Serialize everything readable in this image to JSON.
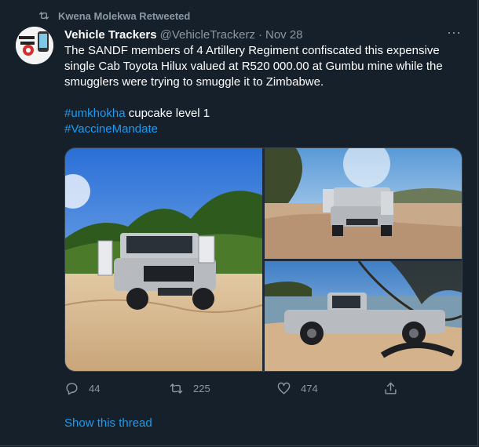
{
  "retweet": {
    "text": "Kwena Molekwa Retweeted"
  },
  "tweet": {
    "author_name": "Vehicle Trackers",
    "handle": "@VehicleTrackerz",
    "separator": "·",
    "date": "Nov 28",
    "more_label": "···",
    "text_line1": "The SANDF members of 4 Artillery Regiment confiscated this expensive",
    "text_line2": "single Cab Toyota Hilux valued at R520 000.00 at Gumbu mine while the",
    "text_line3": "smugglers were trying to smuggle it to Zimbabwe.",
    "hashtag1": "#umkhokha",
    "hashtag1_rest": " cupcake level 1",
    "hashtag2": "#VaccineMandate"
  },
  "actions": {
    "replies": "44",
    "retweets": "225",
    "likes": "474"
  },
  "show_thread": "Show this thread",
  "icons": {
    "retweet": "retweet-icon",
    "reply": "reply-icon",
    "like": "heart-icon",
    "share": "share-icon",
    "more": "more-icon"
  },
  "colors": {
    "background": "#15202b",
    "link": "#1d9bf0",
    "muted": "#8b98a5",
    "text": "#ffffff"
  }
}
